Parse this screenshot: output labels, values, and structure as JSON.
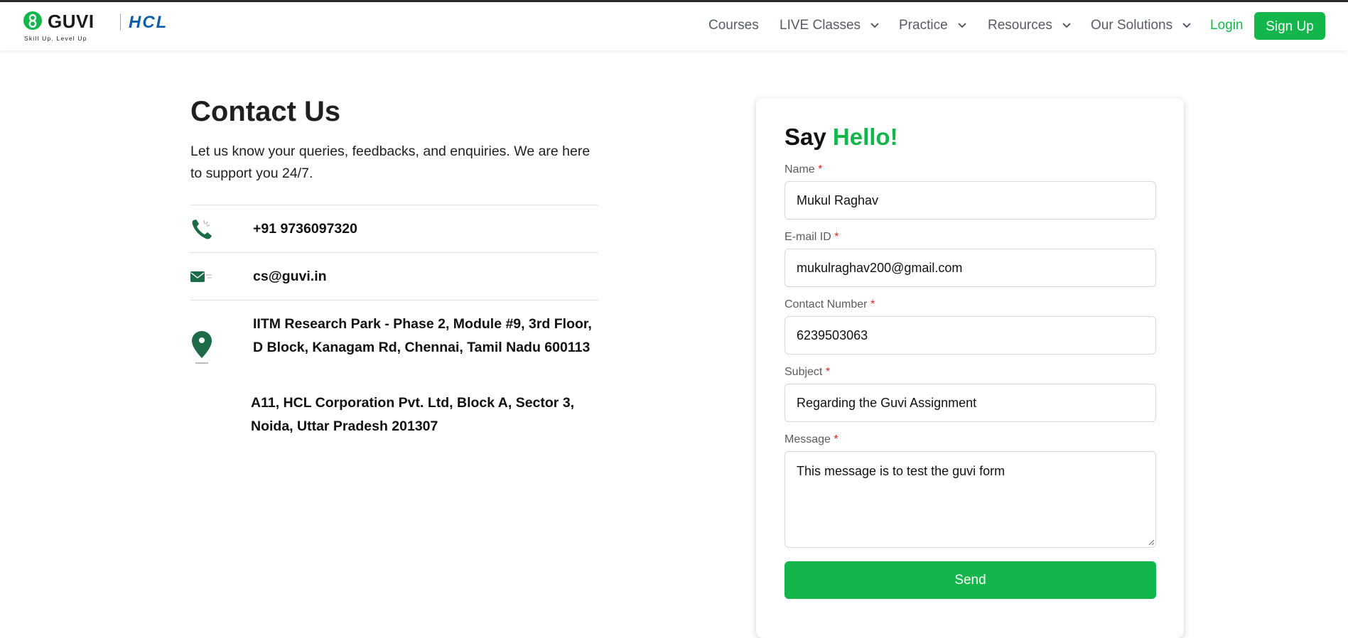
{
  "header": {
    "brand": "GUVI",
    "partner": "HCL",
    "tagline": "Skill Up. Level Up",
    "nav": [
      {
        "label": "Courses"
      },
      {
        "label": "LIVE Classes"
      },
      {
        "label": "Practice"
      },
      {
        "label": "Resources"
      },
      {
        "label": "Our Solutions"
      }
    ],
    "login_label": "Login",
    "signup_label": "Sign Up"
  },
  "contact": {
    "title": "Contact Us",
    "description": "Let us know your queries, feedbacks, and enquiries. We are here to support you 24/7.",
    "phone": "+91 9736097320",
    "email": "cs@guvi.in",
    "address_1": "IITM Research Park - Phase 2, Module #9, 3rd Floor, D Block, Kanagam Rd, Chennai, Tamil Nadu 600113",
    "address_2": "A11, HCL Corporation Pvt. Ltd, Block A, Sector 3, Noida, Uttar Pradesh 201307"
  },
  "form": {
    "heading_prefix": "Say",
    "heading_accent": "Hello!",
    "required_mark": "*",
    "name_label": "Name",
    "name_value": "Mukul Raghav",
    "email_label": "E-mail ID",
    "email_value": "mukulraghav200@gmail.com",
    "contact_label": "Contact Number",
    "contact_value": "6239503063",
    "subject_label": "Subject",
    "subject_value": "Regarding the Guvi Assignment",
    "message_label": "Message",
    "message_value": "This message is to test the guvi form",
    "send_label": "Send"
  },
  "colors": {
    "brand_green": "#12b64a",
    "hcl_blue": "#0f5ea8",
    "icon_green": "#1d6b47"
  },
  "icons": [
    "phone-icon",
    "mail-icon",
    "location-pin-icon",
    "chevron-down-icon"
  ]
}
